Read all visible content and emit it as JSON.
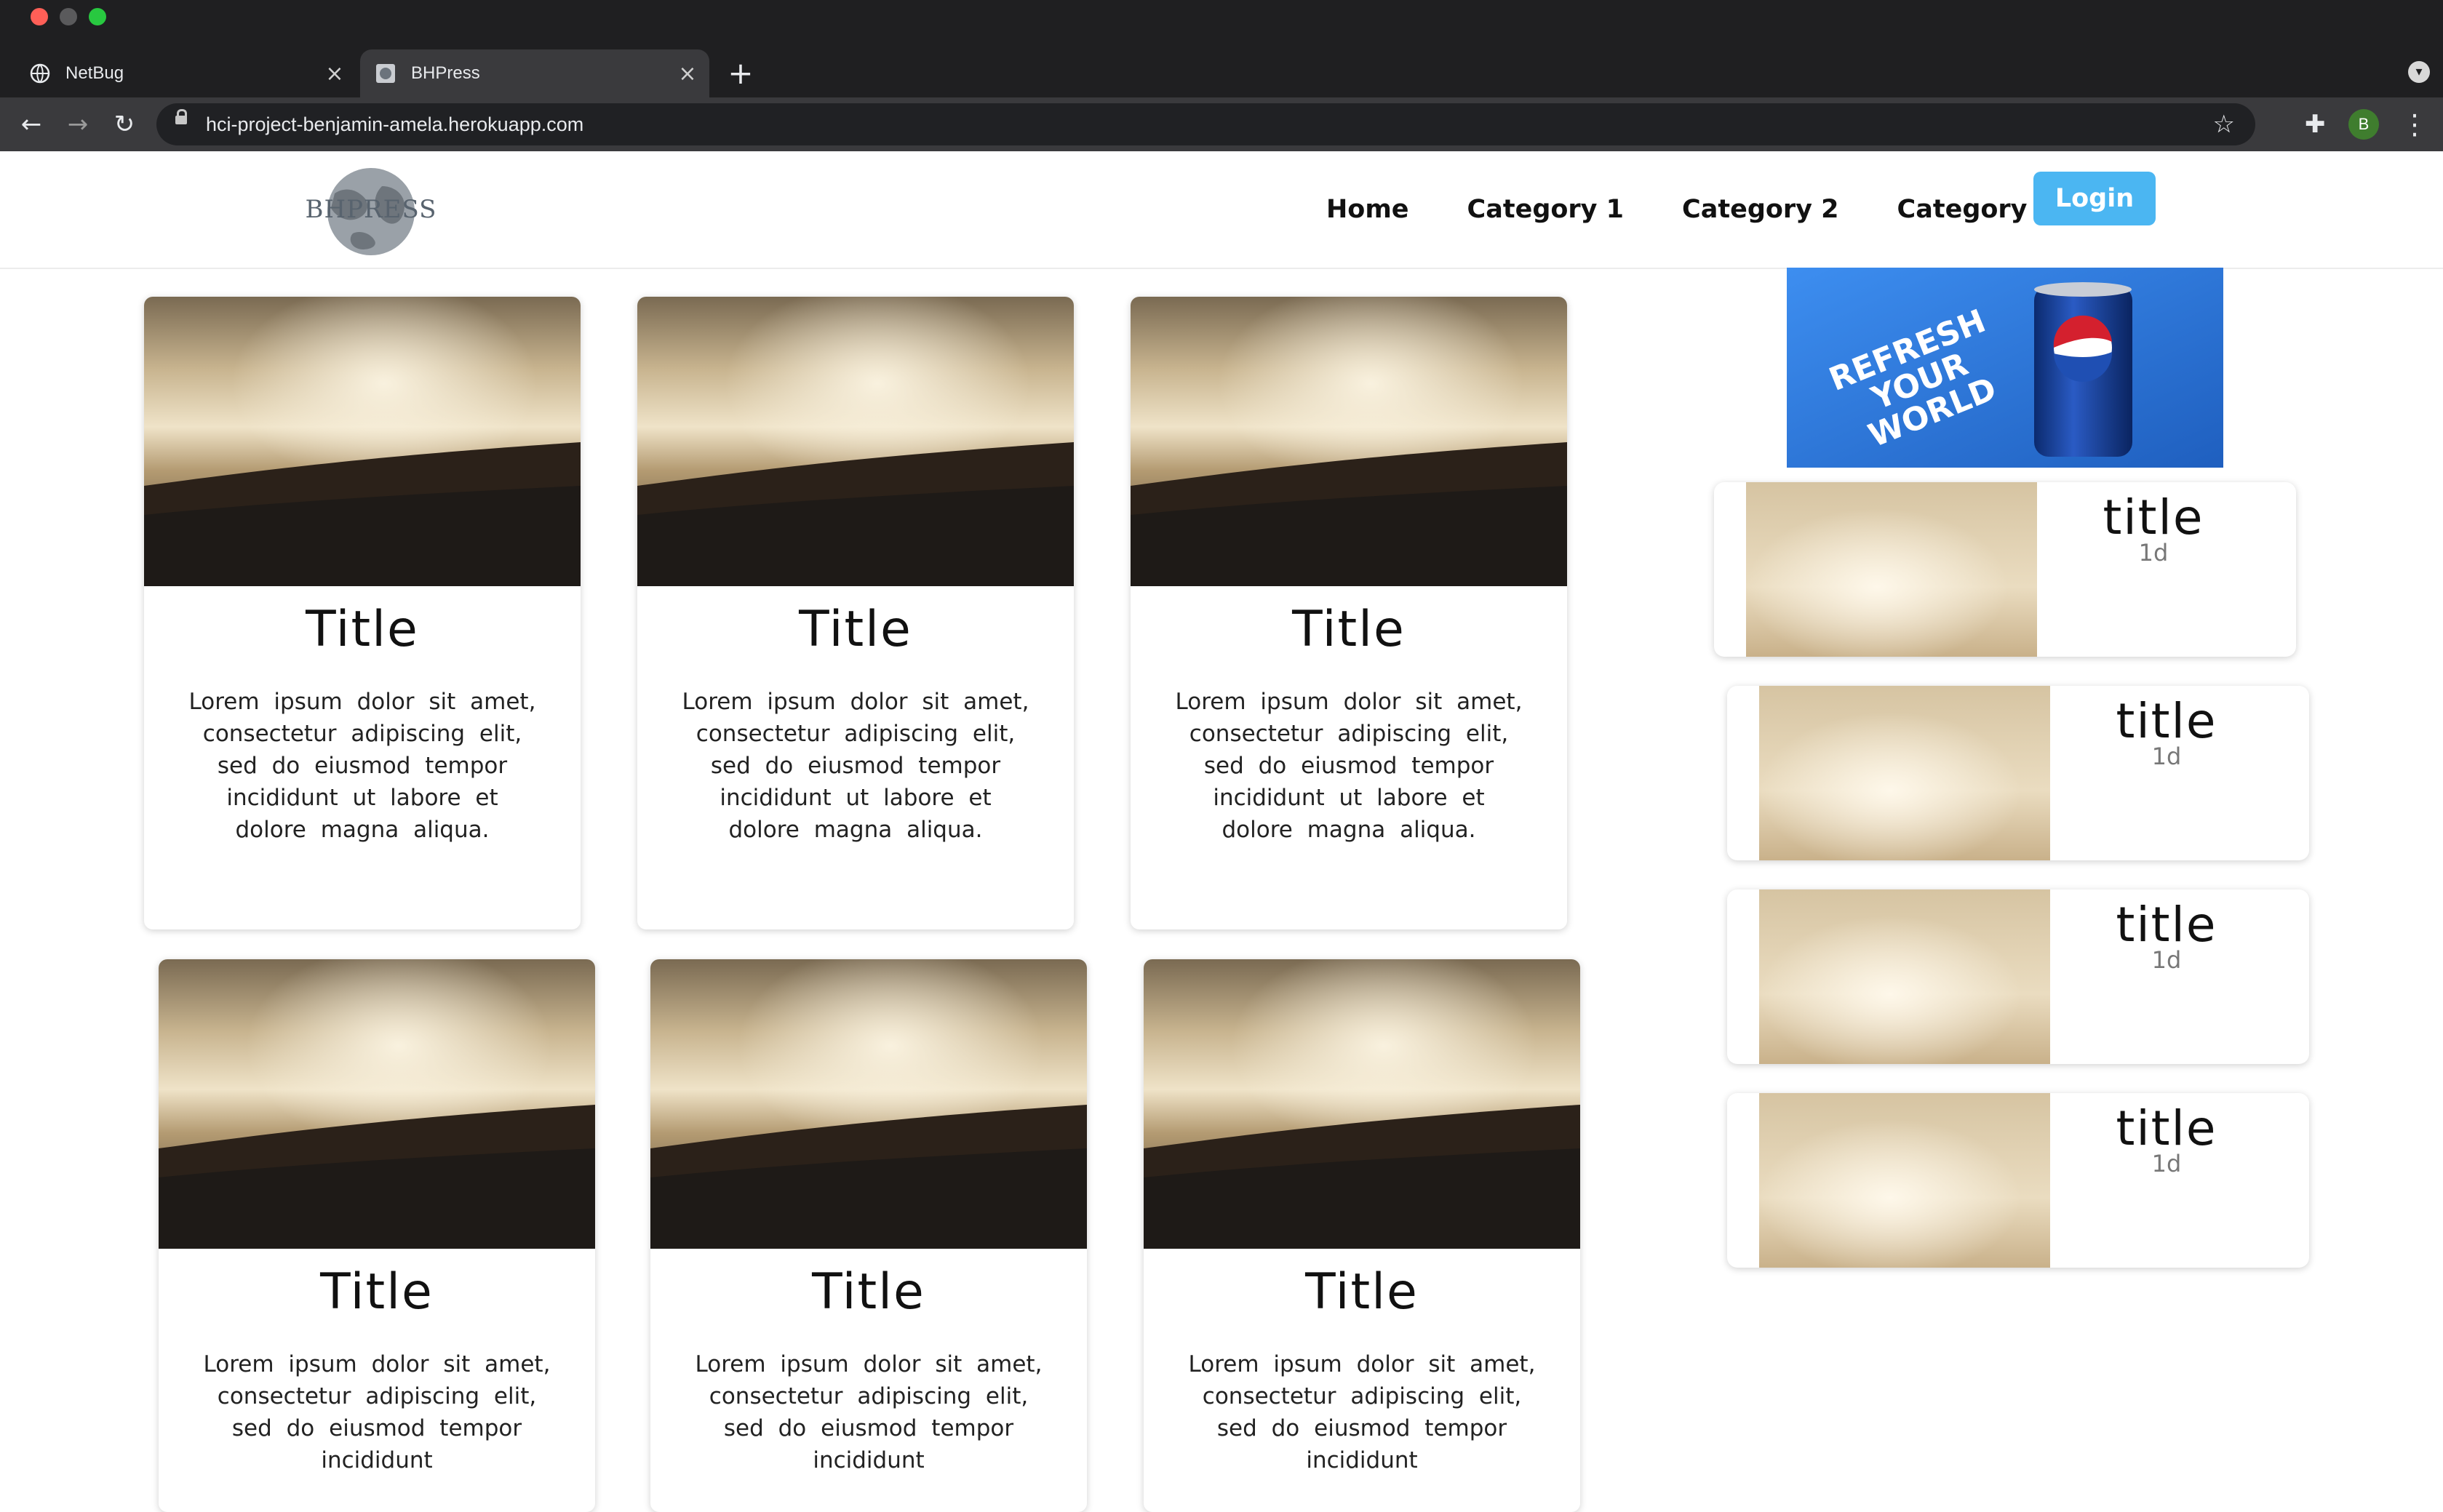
{
  "browser": {
    "tabs": [
      {
        "label": "NetBug",
        "active": false
      },
      {
        "label": "BHPress",
        "active": true
      }
    ],
    "url": "hci-project-benjamin-amela.herokuapp.com",
    "profile_initial": "B"
  },
  "site": {
    "logo_text": "BHPRESS",
    "nav": [
      "Home",
      "Category 1",
      "Category 2",
      "Category 3"
    ],
    "login_label": "Login"
  },
  "ad": {
    "text_lines": [
      "REFRESH",
      "YOUR",
      "WORLD"
    ],
    "brand": "pepsi",
    "background_color": "#2f7fdc"
  },
  "cards": [
    {
      "title": "Title",
      "body": "Lorem ipsum dolor sit amet, consectetur adipiscing elit, sed do eiusmod tempor incididunt ut labore et dolore magna aliqua."
    },
    {
      "title": "Title",
      "body": "Lorem ipsum dolor sit amet, consectetur adipiscing elit, sed do eiusmod tempor incididunt ut labore et dolore magna aliqua."
    },
    {
      "title": "Title",
      "body": "Lorem ipsum dolor sit amet, consectetur adipiscing elit, sed do eiusmod tempor incididunt ut labore et dolore magna aliqua."
    },
    {
      "title": "Title",
      "body": "Lorem ipsum dolor sit amet, consectetur adipiscing elit, sed do eiusmod tempor incididunt"
    },
    {
      "title": "Title",
      "body": "Lorem ipsum dolor sit amet, consectetur adipiscing elit, sed do eiusmod tempor incididunt"
    },
    {
      "title": "Title",
      "body": "Lorem ipsum dolor sit amet, consectetur adipiscing elit, sed do eiusmod tempor incididunt"
    }
  ],
  "sidebar_items": [
    {
      "title": "title",
      "age": "1d"
    },
    {
      "title": "title",
      "age": "1d"
    },
    {
      "title": "title",
      "age": "1d"
    },
    {
      "title": "title",
      "age": "1d"
    }
  ],
  "colors": {
    "accent": "#4bb6f2",
    "chrome_dark": "#1f1f21",
    "chrome_toolbar": "#3a3a3d"
  },
  "icons": [
    "back-arrow-icon",
    "forward-arrow-icon",
    "reload-icon",
    "lock-icon",
    "star-icon",
    "puzzle-icon",
    "kebab-menu-icon",
    "globe-icon",
    "close-icon",
    "plus-icon"
  ]
}
